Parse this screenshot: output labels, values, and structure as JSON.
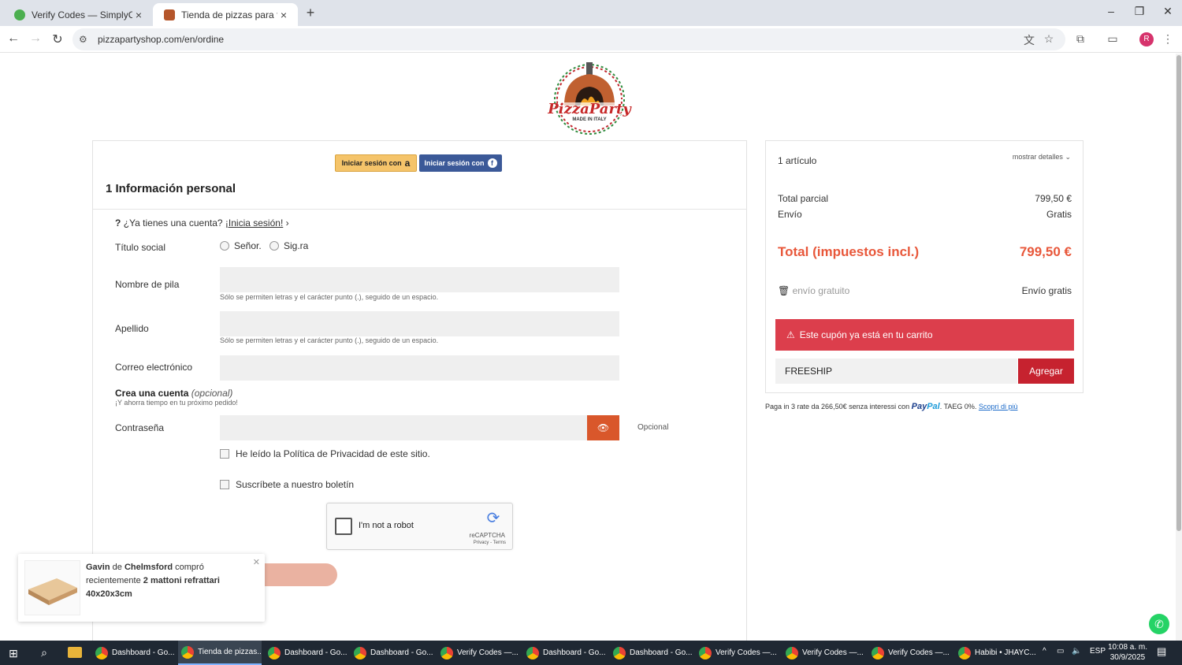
{
  "browser": {
    "tabs": [
      {
        "title": "Verify Codes — SimplyCodes",
        "active": false
      },
      {
        "title": "Tienda de pizzas para fiestas",
        "active": true
      }
    ],
    "url": "pizzapartyshop.com/en/ordine"
  },
  "brand": {
    "logo_text": "PizzaParty",
    "logo_sub": "MADE IN ITALY"
  },
  "login": {
    "amazon_label": "Iniciar sesión con",
    "amazon_glyph": "a",
    "facebook_label": "Iniciar sesión con",
    "facebook_glyph": "f"
  },
  "form": {
    "section_title": "1 Información personal",
    "have_account": "¿Ya tienes una cuenta?",
    "login_link": "¡Inicia sesión!",
    "social_title_label": "Título social",
    "options": [
      "Señor.",
      "Sig.ra"
    ],
    "first_name_label": "Nombre de pila",
    "last_name_label": "Apellido",
    "email_label": "Correo electrónico",
    "name_hint": "Sólo se permiten letras y el carácter punto (.), seguido de un espacio.",
    "create_account": "Crea una cuenta",
    "optional_tag": "(opcional)",
    "save_time": "¡Y ahorra tiempo en tu próximo pedido!",
    "password_label": "Contraseña",
    "optional": "Opcional",
    "privacy": "He leído la Política de Privacidad de este sitio.",
    "newsletter": "Suscríbete a nuestro boletín"
  },
  "captcha": {
    "label": "I'm not a robot",
    "brand": "reCAPTCHA",
    "terms": "Privacy - Terms"
  },
  "summary": {
    "items": "1 artículo",
    "show_details": "mostrar detalles",
    "subtotal_label": "Total parcial",
    "subtotal": "799,50 €",
    "shipping_label": "Envío",
    "shipping": "Gratis",
    "total_label": "Total (impuestos incl.)",
    "total": "799,50 €",
    "free_label": "envío gratuito",
    "free_value": "Envío gratis",
    "alert": "Este cupón ya está en tu carrito",
    "coupon": "FREESHIP",
    "add": "Agregar"
  },
  "paypal": {
    "text": "Paga in 3 rate da 266,50€ senza interessi con",
    "brand_pay": "Pay",
    "brand_pal": "Pal",
    "taeg": ". TAEG 0%.",
    "link": "Scopri di più"
  },
  "toast": {
    "name": "Gavin",
    "from": "de",
    "city": "Chelmsford",
    "action": "compró recientemente",
    "product": "2 mattoni refrattari 40x20x3cm"
  },
  "taskbar": {
    "apps": [
      "Dashboard - Go...",
      "Tienda de pizzas...",
      "Dashboard - Go...",
      "Dashboard - Go...",
      "Verify Codes —...",
      "Dashboard - Go...",
      "Dashboard - Go...",
      "Verify Codes —...",
      "Verify Codes —...",
      "Verify Codes —...",
      "Habibi • JHAYC..."
    ],
    "lang": "ESP",
    "time": "10:08 a. m.",
    "date": "30/9/2025"
  },
  "colors": {
    "accent": "#e8573a",
    "alert": "#dc3e4c",
    "add_button": "#c6222f",
    "facebook": "#3b5998",
    "amazon": "#f5c46a"
  }
}
